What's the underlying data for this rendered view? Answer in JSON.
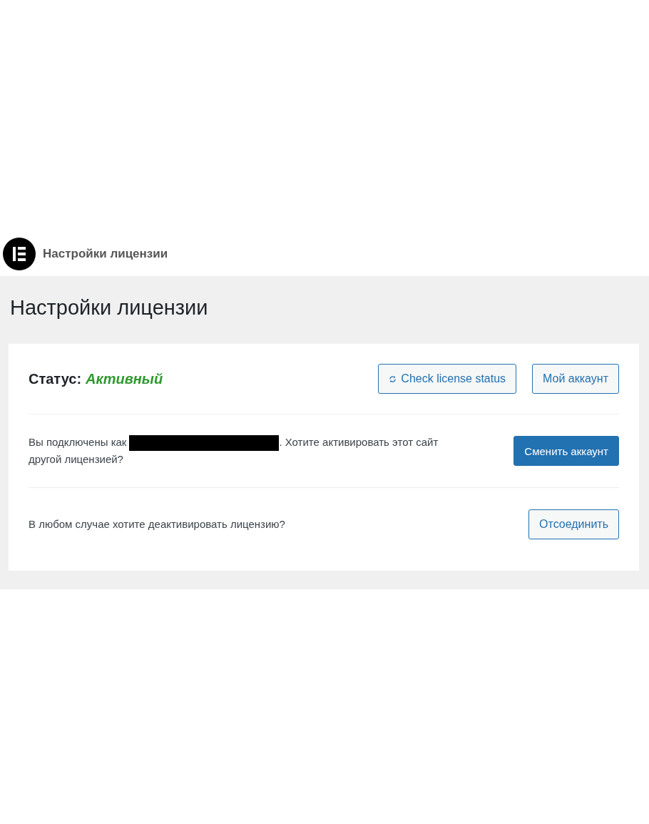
{
  "header": {
    "title": "Настройки лицензии"
  },
  "page": {
    "heading": "Настройки лицензии"
  },
  "status": {
    "label": "Статус:",
    "value": "Активный",
    "active": true
  },
  "status_buttons": [
    {
      "label": "Check license status",
      "kind": "check"
    },
    {
      "label": "Мой аккаунт",
      "kind": "account"
    }
  ],
  "rows": [
    {
      "kind": "connected",
      "text_before": "Вы подключены как",
      "text_after": ". Хотите активировать этот сайт другой лицензией?",
      "button": {
        "label": "Сменить аккаунт",
        "kind": "primary"
      }
    },
    {
      "kind": "plain",
      "text_before": "В любом случае хотите деактивировать лицензию?",
      "button": {
        "label": "Отсоединить",
        "kind": "outline"
      }
    }
  ]
}
